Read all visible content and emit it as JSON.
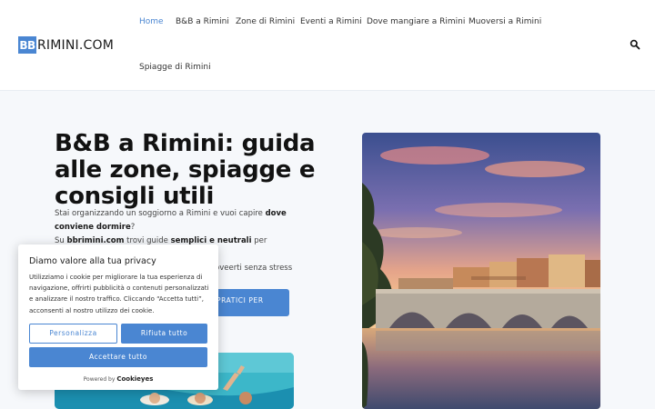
{
  "header": {
    "logo": {
      "badge": "BB",
      "text": "RIMINI.COM"
    },
    "nav": [
      {
        "label": "Home"
      },
      {
        "label": "B&B a Rimini"
      },
      {
        "label": "Zone di Rimini"
      },
      {
        "label": "Eventi a Rimini"
      },
      {
        "label": "Dove mangiare a Rimini"
      },
      {
        "label": "Muoversi a Rimini"
      },
      {
        "label": "Spiagge di Rimini"
      }
    ]
  },
  "hero": {
    "title": "B&B a Rimini: guida alle zone, spiagge e consigli utili",
    "p1_a": "Stai organizzando un soggiorno a Rimini e vuoi capire ",
    "p1_b": "dove conviene dormire",
    "p1_c": "?",
    "p2_a": "bbrimini.com",
    "p2_b": " trovi guide ",
    "p2_c": "semplici e neutrali",
    "p2_d": " per scegliere la",
    "p2_prefix": "Su ",
    "p3": "oveerti senza stress",
    "cta": "PRATICI PER"
  },
  "cookie": {
    "title": "Diamo valore alla tua privacy",
    "body": "Utilizziamo i cookie per migliorare la tua esperienza di navigazione, offrirti pubblicità o contenuti personalizzati e analizzare il nostro traffico. Cliccando “Accetta tutti”, acconsenti al nostro utilizzo dei cookie.",
    "customize": "Personalizza",
    "reject": "Rifiuta tutto",
    "accept": "Accettare tutto",
    "powered_by": "Powered by",
    "brand": "Cookieyes"
  },
  "colors": {
    "accent": "#4a86d2",
    "text": "#121212",
    "background": "#f6f8fb"
  },
  "icons": {
    "search": "search-icon"
  }
}
